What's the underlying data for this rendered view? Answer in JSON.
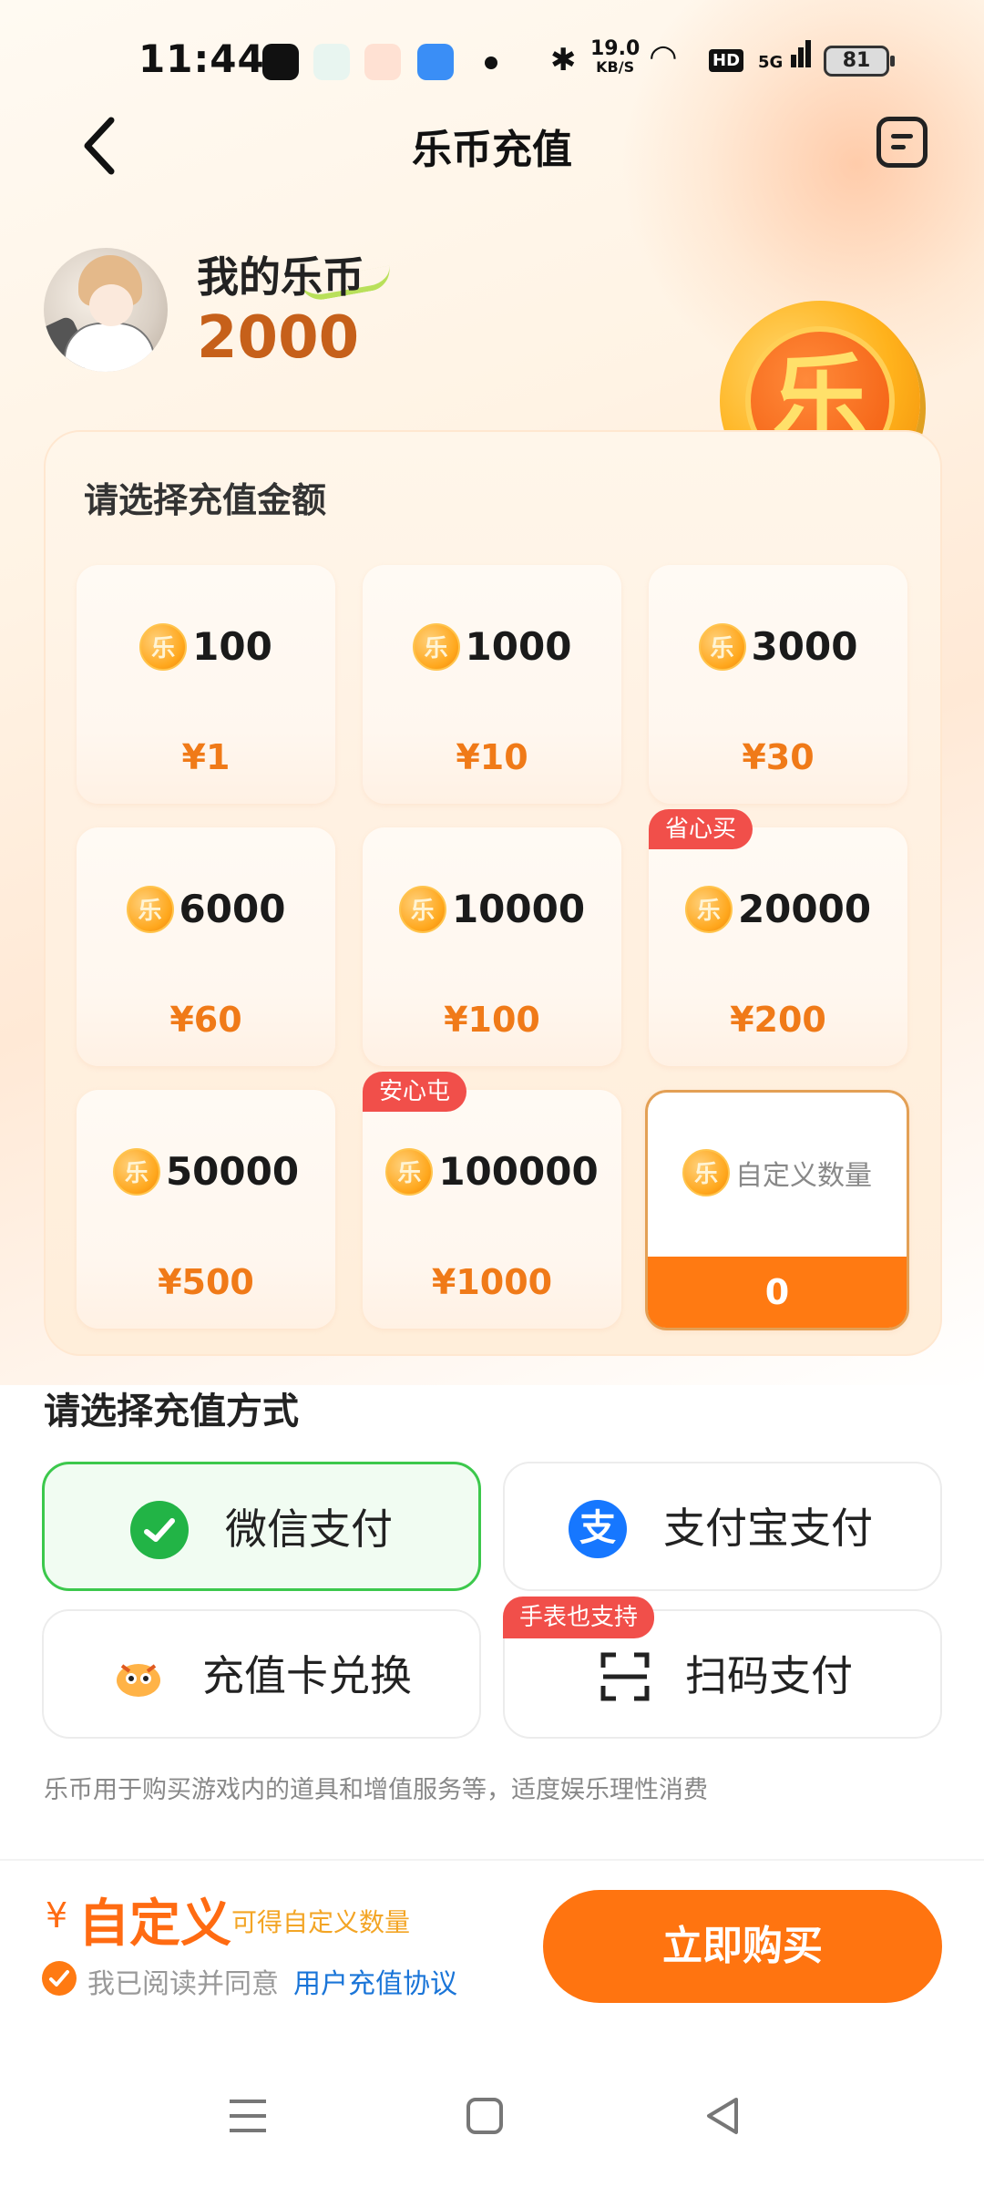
{
  "status_bar": {
    "time": "11:44",
    "net_speed": "19.0",
    "net_unit": "KB/S",
    "hd": "HD",
    "signal": "5G",
    "battery": "81"
  },
  "header": {
    "title": "乐币充值",
    "back_icon": "chevron-left-icon",
    "menu_icon": "document-list-icon"
  },
  "balance": {
    "label": "我的乐币",
    "value": "2000",
    "coin_glyph": "乐"
  },
  "amount_section": {
    "title": "请选择充值金额",
    "coin_glyph": "乐",
    "options": [
      {
        "coins": "100",
        "price": "¥1",
        "tag": ""
      },
      {
        "coins": "1000",
        "price": "¥10",
        "tag": ""
      },
      {
        "coins": "3000",
        "price": "¥30",
        "tag": ""
      },
      {
        "coins": "6000",
        "price": "¥60",
        "tag": ""
      },
      {
        "coins": "10000",
        "price": "¥100",
        "tag": ""
      },
      {
        "coins": "20000",
        "price": "¥200",
        "tag": "省心买"
      },
      {
        "coins": "50000",
        "price": "¥500",
        "tag": ""
      },
      {
        "coins": "100000",
        "price": "¥1000",
        "tag": "安心屯"
      }
    ],
    "custom": {
      "placeholder": "自定义数量",
      "price": "0"
    }
  },
  "payment": {
    "title": "请选择充值方式",
    "methods": [
      {
        "label": "微信支付",
        "icon": "wechat-icon",
        "selected": true
      },
      {
        "label": "支付宝支付",
        "icon": "alipay-icon",
        "selected": false
      },
      {
        "label": "充值卡兑换",
        "icon": "mascot-card-icon",
        "selected": false
      },
      {
        "label": "扫码支付",
        "icon": "scan-icon",
        "selected": false,
        "tag": "手表也支持"
      }
    ],
    "alipay_glyph": "支",
    "notice": "乐币用于购买游戏内的道具和增值服务等，适度娱乐理性消费"
  },
  "checkout": {
    "currency": "¥",
    "amount": "自定义",
    "hint": "可得自定义数量",
    "agree_text": "我已阅读并同意",
    "agree_link": "用户充值协议",
    "buy_label": "立即购买"
  },
  "colors": {
    "accent": "#ff7410",
    "price": "#f07a18",
    "tag": "#f14f4a",
    "wechat": "#22b446",
    "alipay": "#1677ff",
    "link": "#1a75d8"
  }
}
